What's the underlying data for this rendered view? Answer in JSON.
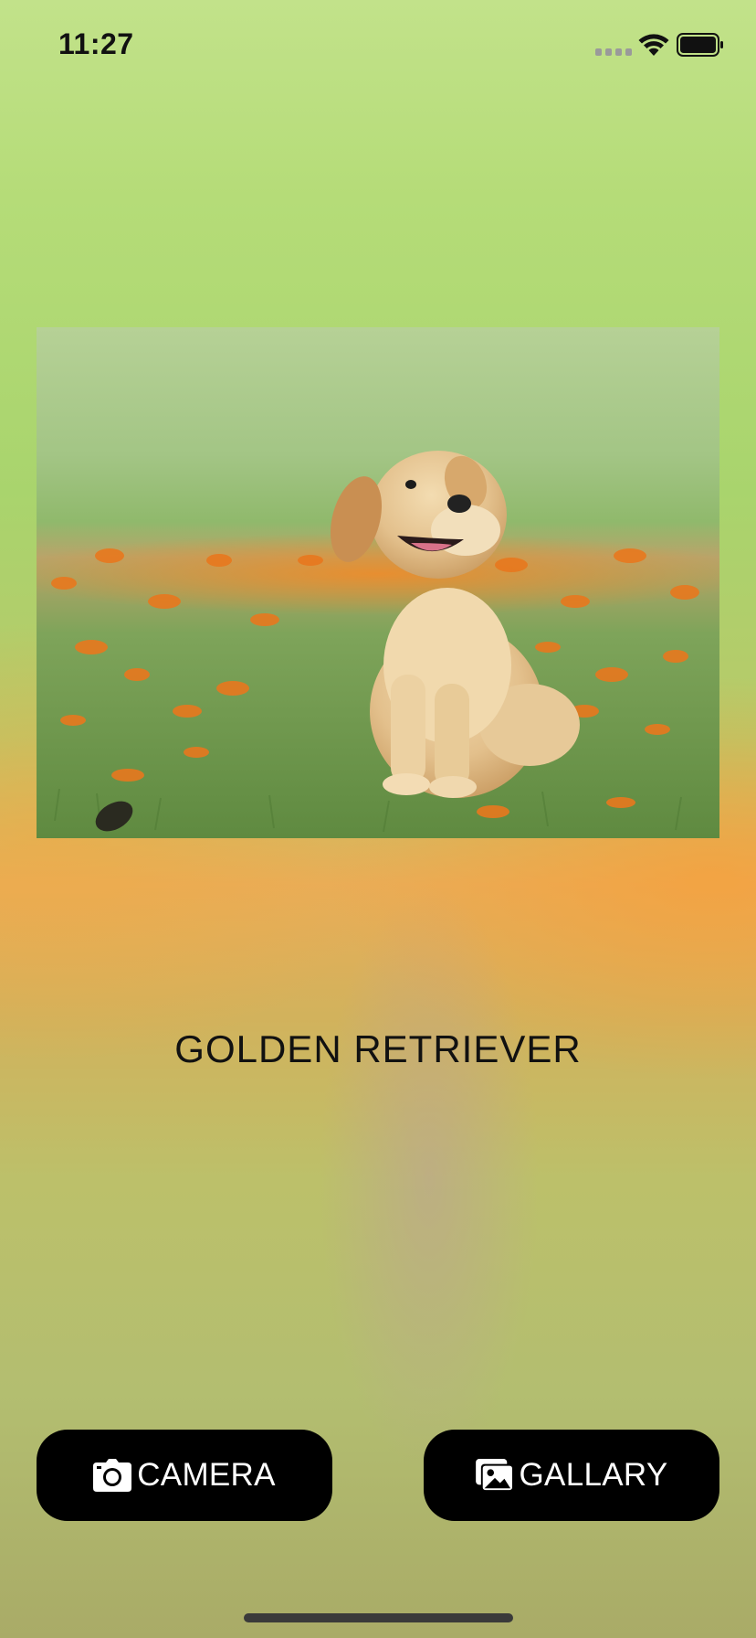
{
  "status_bar": {
    "time": "11:27",
    "icons": [
      "cellular-signal-icon",
      "wifi-icon",
      "battery-icon"
    ]
  },
  "photo": {
    "subject": "golden-retriever-puppy-photo"
  },
  "prediction": {
    "label": "GOLDEN RETRIEVER"
  },
  "buttons": {
    "camera": {
      "label": "CAMERA",
      "icon": "camera-icon"
    },
    "gallery": {
      "label": "GALLARY",
      "icon": "photo-library-icon"
    }
  },
  "colors": {
    "button_bg": "#000000",
    "button_text": "#ffffff",
    "label_text": "#111111"
  }
}
